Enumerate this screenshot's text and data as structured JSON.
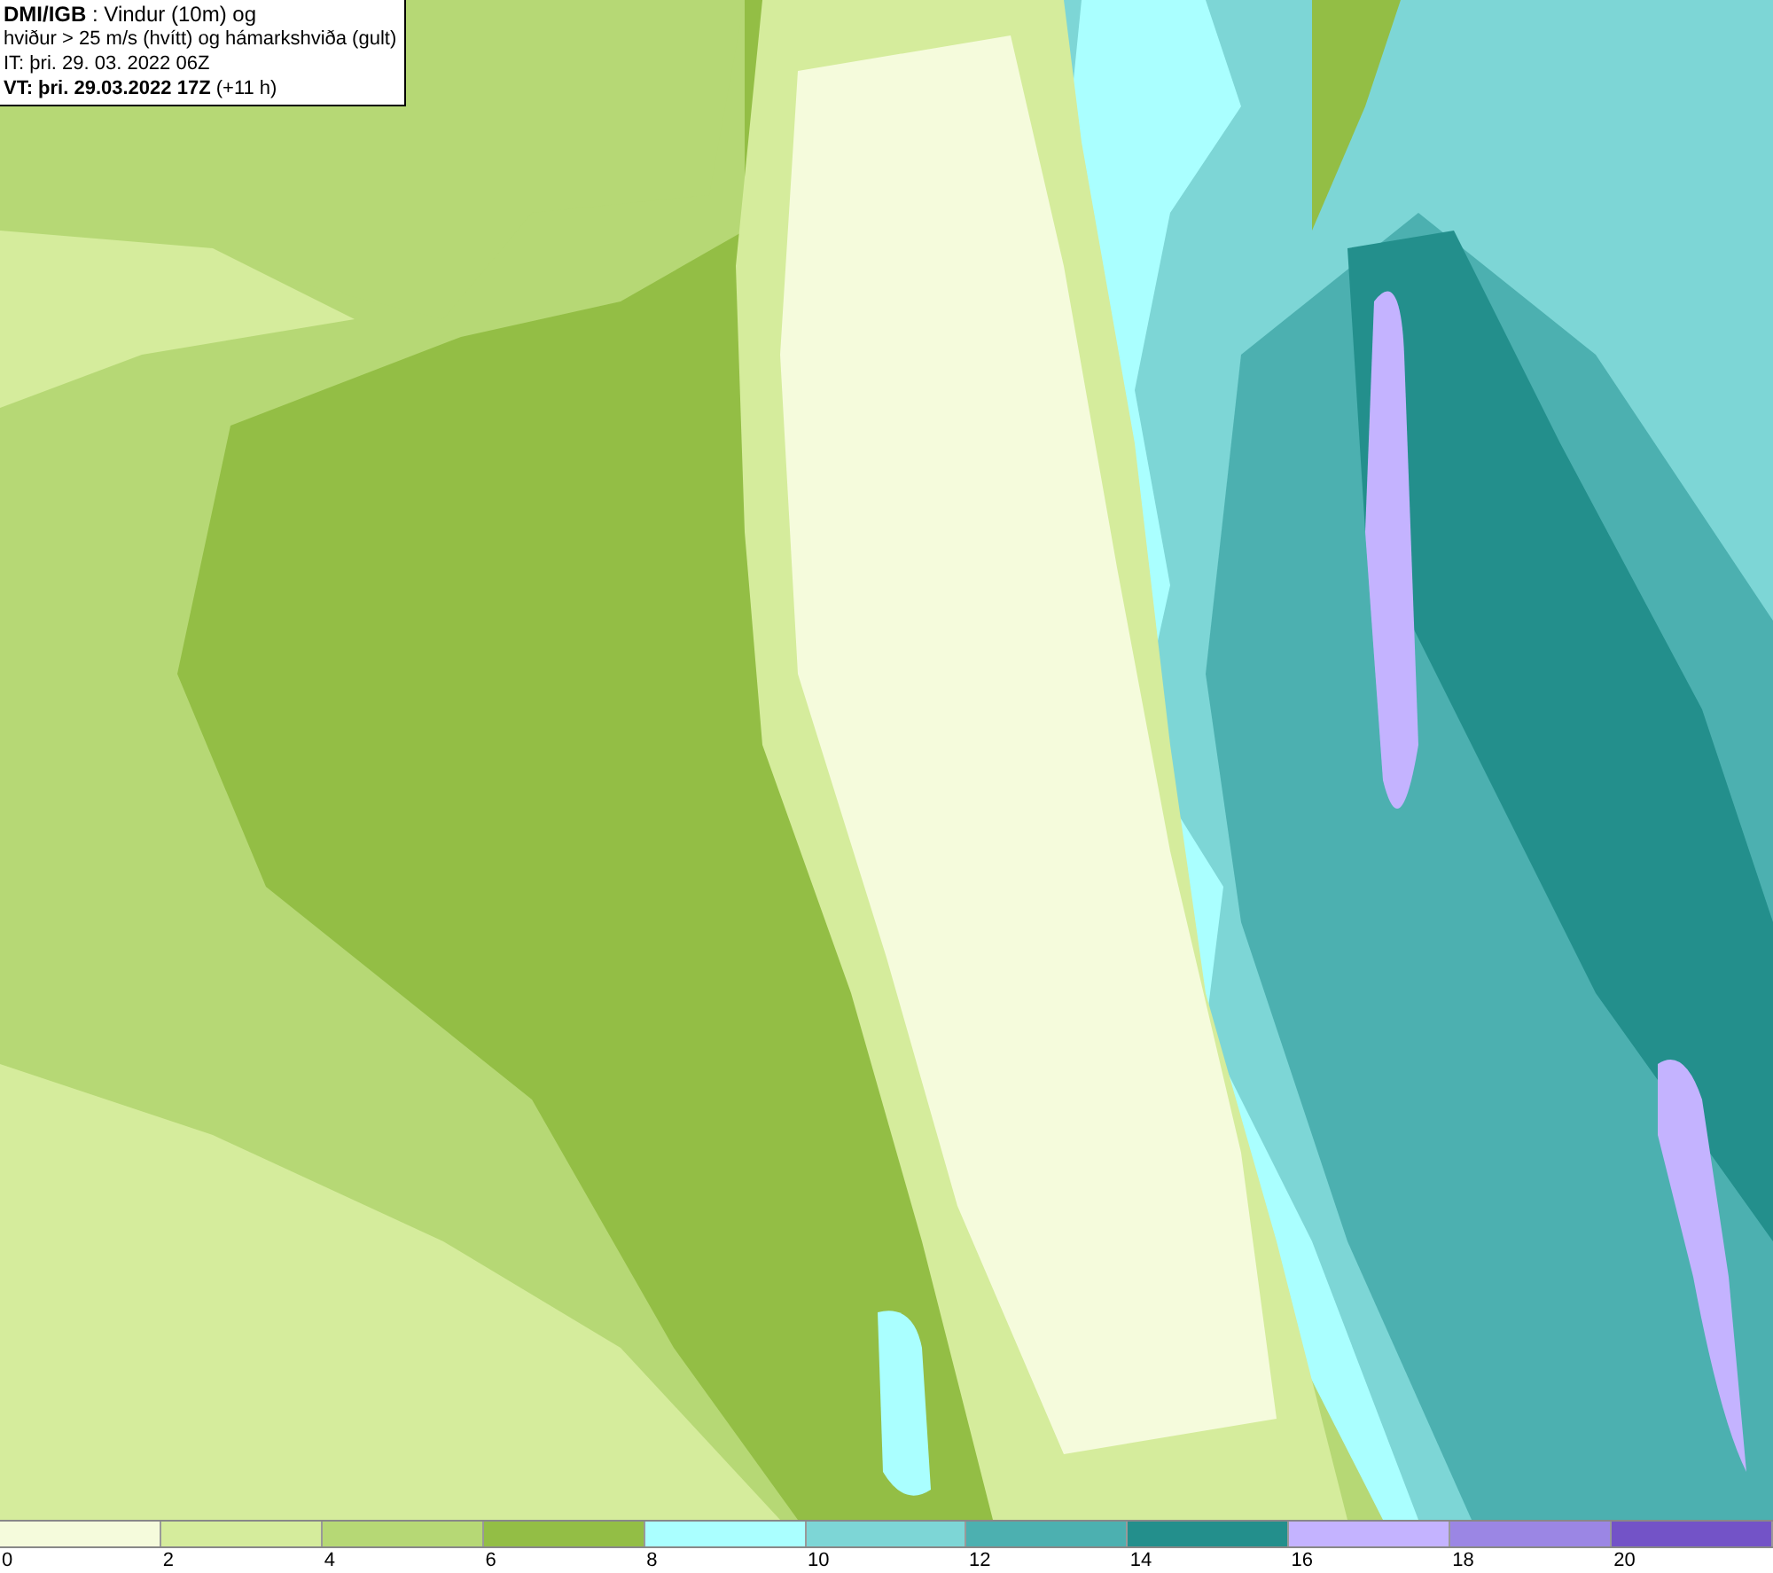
{
  "header": {
    "lines": [
      "**DMI/IGB** : Vindur (10m) og",
      "hviður > 25 m/s (hvítt) og hámarkshviða (gult)",
      "IT: þri. 29. 03. 2022 06Z",
      "**VT: þri. 29.03.2022 17Z** (+11 h)"
    ]
  },
  "legend": [
    {
      "label": "0",
      "color": "#f5fbdc"
    },
    {
      "label": "2",
      "color": "#d5ec9c"
    },
    {
      "label": "4",
      "color": "#b6d875"
    },
    {
      "label": "6",
      "color": "#93be45"
    },
    {
      "label": "8",
      "color": "#aaffff"
    },
    {
      "label": "10",
      "color": "#7dd6d6"
    },
    {
      "label": "12",
      "color": "#4cb0b0"
    },
    {
      "label": "14",
      "color": "#238f8c"
    },
    {
      "label": "16",
      "color": "#c4b3ff"
    },
    {
      "label": "18",
      "color": "#9b86e4"
    },
    {
      "label": "20",
      "color": "#7353c7"
    }
  ]
}
